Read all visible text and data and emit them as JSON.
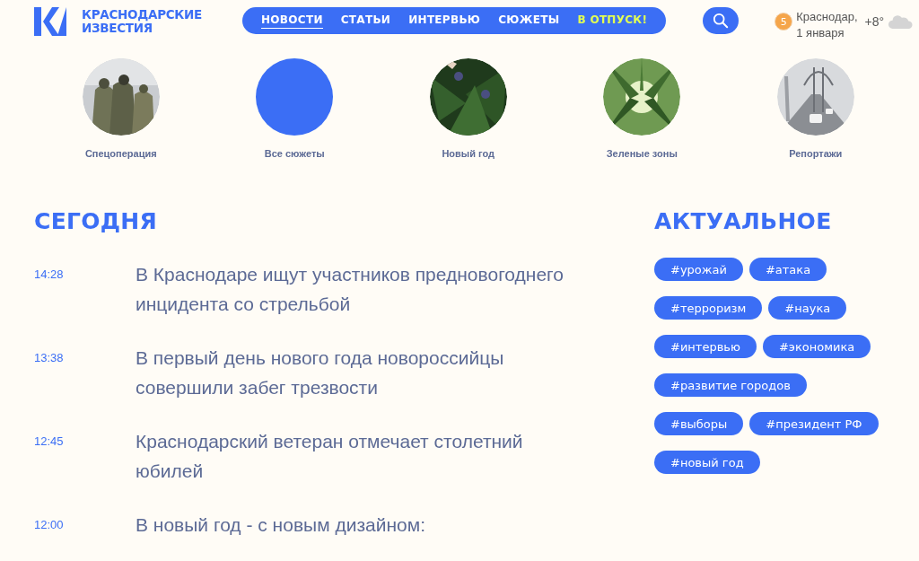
{
  "logo": {
    "line1": "КРАСНОДАРСКИЕ",
    "line2": "ИЗВЕСТИЯ"
  },
  "nav": [
    {
      "label": "НОВОСТИ",
      "selected": true,
      "kind": "link"
    },
    {
      "label": "СТАТЬИ",
      "selected": false,
      "kind": "link"
    },
    {
      "label": "ИНТЕРВЬЮ",
      "selected": false,
      "kind": "link"
    },
    {
      "label": "СЮЖЕТЫ",
      "selected": false,
      "kind": "link"
    },
    {
      "label": "В ОТПУСК!",
      "selected": false,
      "kind": "promo"
    }
  ],
  "weather": {
    "badge": "5",
    "city": "Краснодар,",
    "date": "1 января",
    "temperature": "+8°"
  },
  "stories": [
    {
      "label": "Спецоперация",
      "kind": "picture"
    },
    {
      "label": "Все сюжеты",
      "kind": "all"
    },
    {
      "label": "Новый год",
      "kind": "picture"
    },
    {
      "label": "Зеленые зоны",
      "kind": "picture"
    },
    {
      "label": "Репортажи",
      "kind": "picture"
    }
  ],
  "today": {
    "heading": "СЕГОДНЯ",
    "news": [
      {
        "time": "14:28",
        "title": "В Краснодаре ищут участников предновогоднего инцидента со стрельбой"
      },
      {
        "time": "13:38",
        "title": "В первый день нового года новороссийцы совершили забег трезвости"
      },
      {
        "time": "12:45",
        "title": "Краснодарский ветеран отмечает столетний юбилей"
      },
      {
        "time": "12:00",
        "title": "В новый год - с новым дизайном:"
      }
    ]
  },
  "trending": {
    "heading": "АКТУАЛЬНОЕ",
    "tag_rows": [
      [
        "#урожай",
        "#атака"
      ],
      [
        "#терроризм",
        "#наука"
      ],
      [
        "#интервью",
        "#экономика"
      ],
      [
        "#развитие городов"
      ],
      [
        "#выборы",
        "#президент РФ"
      ],
      [
        "#новый год"
      ]
    ]
  }
}
